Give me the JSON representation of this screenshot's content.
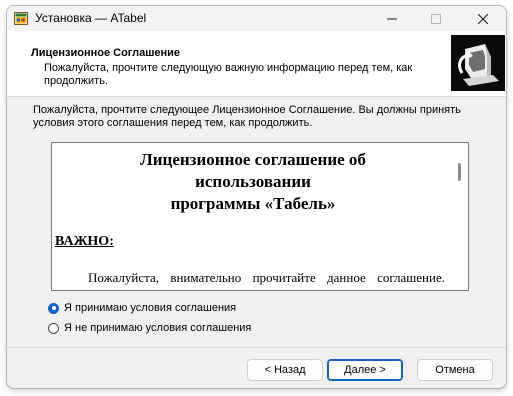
{
  "window": {
    "title": "Установка — ATabel"
  },
  "header": {
    "title": "Лицензионное Соглашение",
    "description": "Пожалуйста, прочтите следующую важную информацию перед тем, как продолжить."
  },
  "main": {
    "intro": "Пожалуйста, прочтите следующее Лицензионное Соглашение. Вы должны принять условия этого соглашения перед тем, как продолжить.",
    "license": {
      "heading_line1": "Лицензионное соглашение об",
      "heading_line2": "использовании",
      "heading_line3": "программы «Табель»",
      "important": "ВАЖНО:",
      "paragraph": "Пожалуйста, внимательно прочитайте данное соглашение. Использование данной программы (далее по тексту"
    },
    "radio_accept": "Я принимаю условия соглашения",
    "radio_decline": "Я не принимаю условия соглашения",
    "selected": "accept"
  },
  "buttons": {
    "back": "< Назад",
    "next": "Далее >",
    "cancel": "Отмена"
  },
  "colors": {
    "accent": "#0f62c7"
  }
}
